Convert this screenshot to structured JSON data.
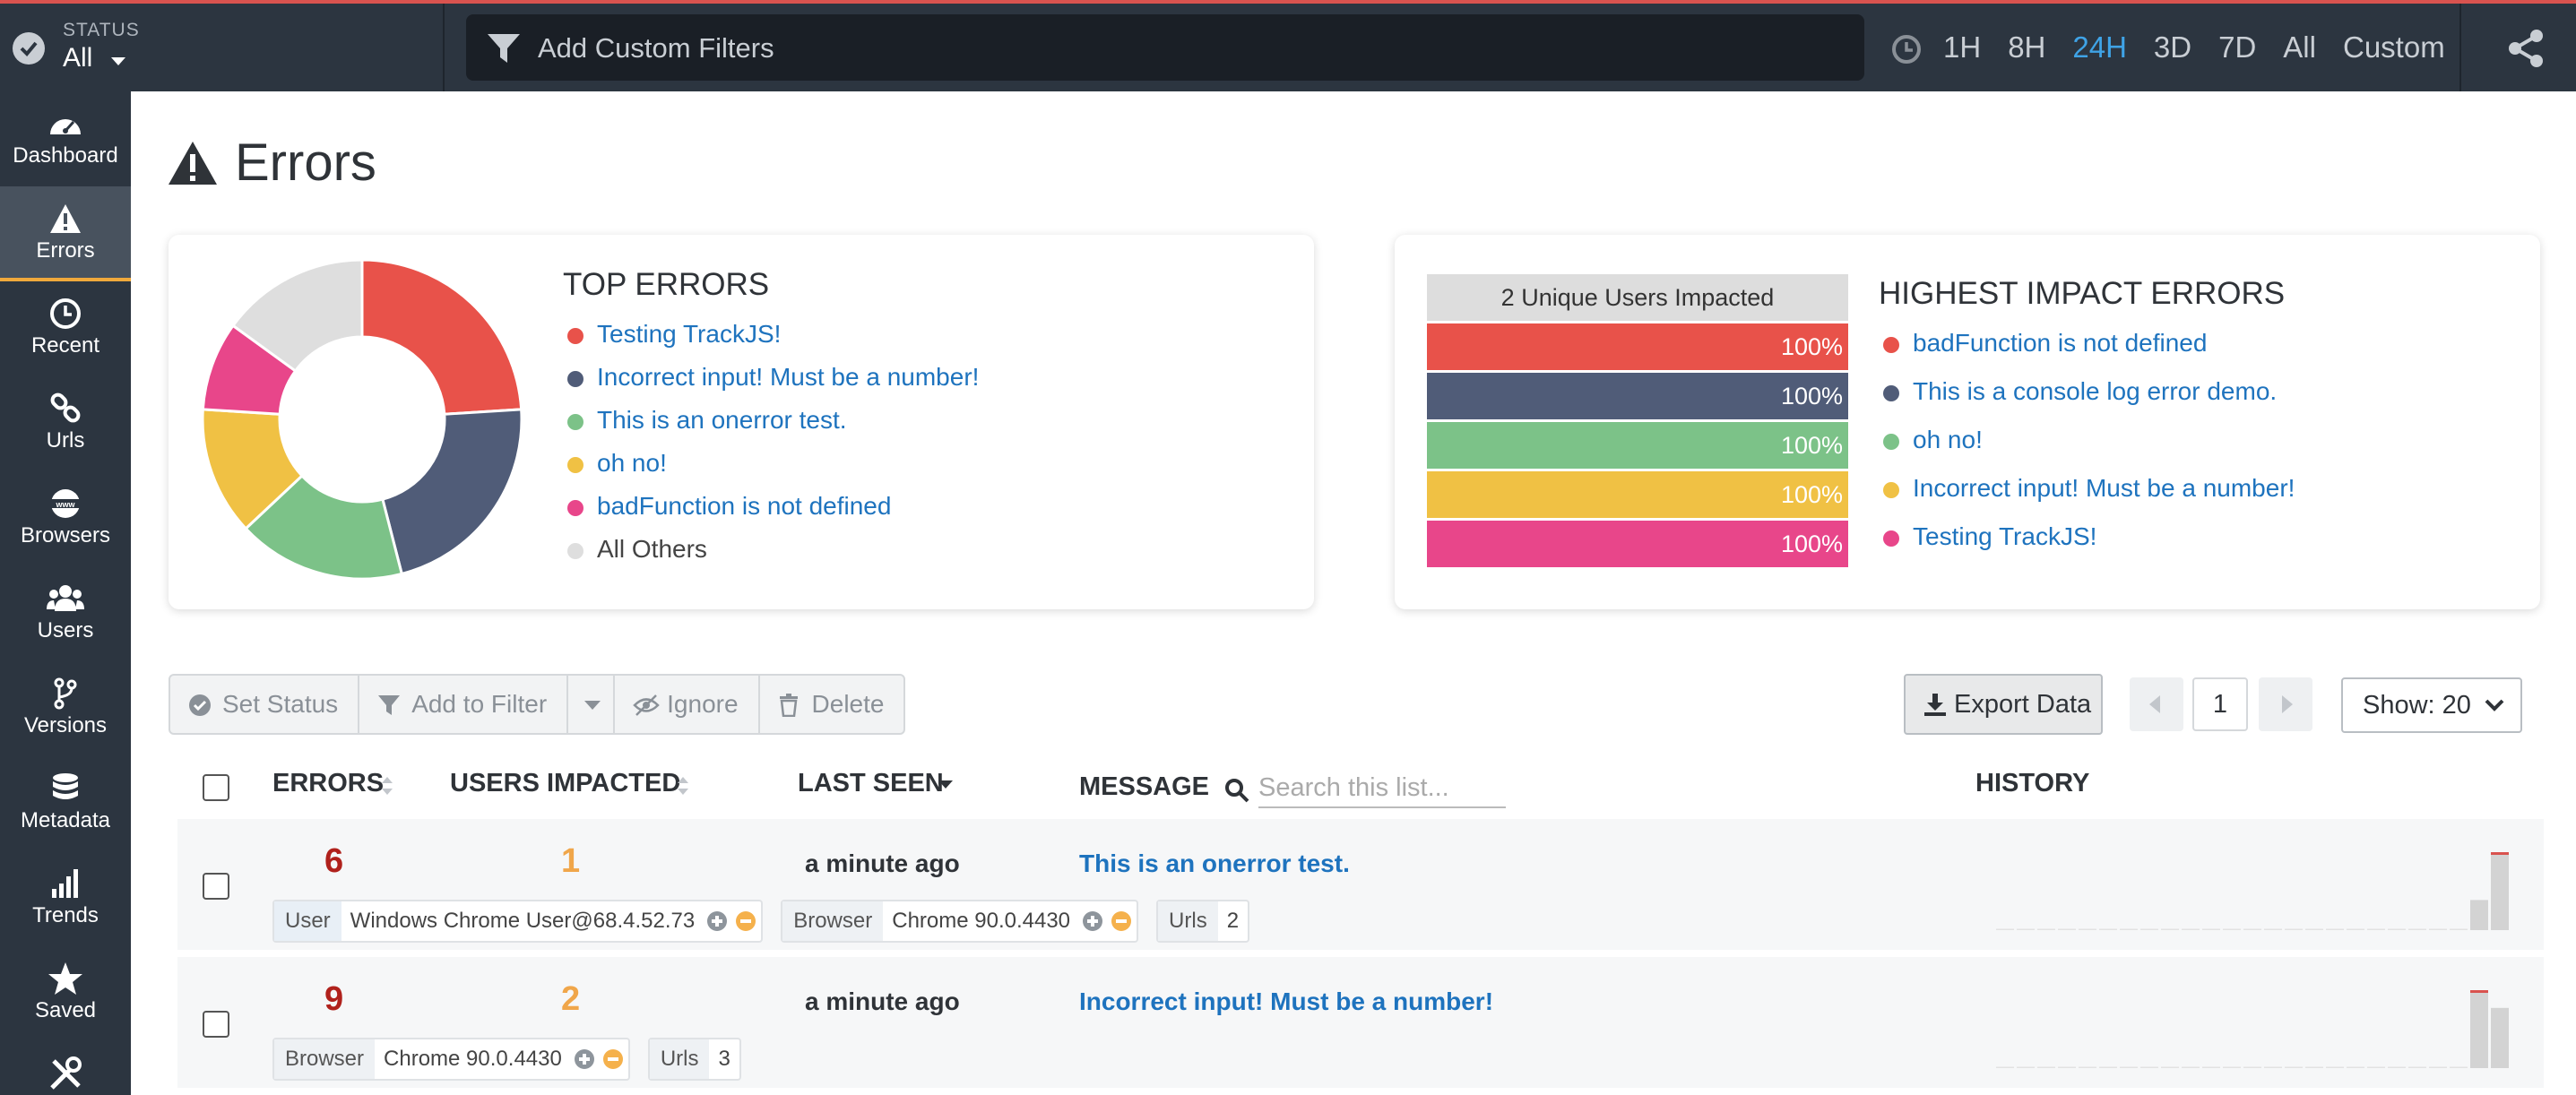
{
  "topbar": {
    "status_caption": "STATUS",
    "status_value": "All",
    "filter_placeholder": "Add Custom Filters",
    "time_ranges": [
      "1H",
      "8H",
      "24H",
      "3D",
      "7D",
      "All",
      "Custom"
    ],
    "active_range": "24H",
    "accent_color": "#3fa3e6"
  },
  "sidebar": {
    "items": [
      {
        "label": "Dashboard",
        "icon": "dashboard-icon"
      },
      {
        "label": "Errors",
        "icon": "warning-icon",
        "active": true
      },
      {
        "label": "Recent",
        "icon": "clock-icon"
      },
      {
        "label": "Urls",
        "icon": "link-icon"
      },
      {
        "label": "Browsers",
        "icon": "www-icon"
      },
      {
        "label": "Users",
        "icon": "users-icon"
      },
      {
        "label": "Versions",
        "icon": "branch-icon"
      },
      {
        "label": "Metadata",
        "icon": "database-icon"
      },
      {
        "label": "Trends",
        "icon": "bar-chart-icon"
      },
      {
        "label": "Saved",
        "icon": "star-icon"
      },
      {
        "label": "",
        "icon": "tools-icon"
      }
    ]
  },
  "page": {
    "title": "Errors"
  },
  "top_errors": {
    "title": "TOP ERRORS",
    "items": [
      {
        "label": "Testing TrackJS!",
        "color": "#e8524a",
        "share": 0.24
      },
      {
        "label": "Incorrect input! Must be a number!",
        "color": "#505c78",
        "share": 0.22
      },
      {
        "label": "This is an onerror test.",
        "color": "#7cc288",
        "share": 0.17
      },
      {
        "label": "oh no!",
        "color": "#f0c144",
        "share": 0.13
      },
      {
        "label": "badFunction is not defined",
        "color": "#e8468a",
        "share": 0.09
      },
      {
        "label": "All Others",
        "color": "#dedede",
        "share": 0.15
      }
    ]
  },
  "impact": {
    "title": "HIGHEST IMPACT ERRORS",
    "bar_header": "2 Unique Users Impacted",
    "items": [
      {
        "label": "badFunction is not defined",
        "percent": "100%",
        "color": "#e8524a"
      },
      {
        "label": "This is a console log error demo.",
        "percent": "100%",
        "color": "#505c78"
      },
      {
        "label": "oh no!",
        "percent": "100%",
        "color": "#7cc288"
      },
      {
        "label": "Incorrect input! Must be a number!",
        "percent": "100%",
        "color": "#f0c144"
      },
      {
        "label": "Testing TrackJS!",
        "percent": "100%",
        "color": "#e8468a"
      }
    ]
  },
  "toolbar": {
    "set_status": "Set Status",
    "add_to_filter": "Add to Filter",
    "ignore": "Ignore",
    "delete": "Delete",
    "export": "Export Data",
    "page": "1",
    "show": "Show: 20"
  },
  "table": {
    "headers": {
      "errors": "ERRORS",
      "users": "USERS IMPACTED",
      "last_seen": "LAST SEEN",
      "message": "MESSAGE",
      "history": "HISTORY"
    },
    "search_placeholder": "Search this list...",
    "rows": [
      {
        "errors": "6",
        "users": "1",
        "last_seen": "a minute ago",
        "message": "This is an onerror test.",
        "tags": [
          {
            "key": "User",
            "value": "Windows Chrome User@68.4.52.73",
            "filterable": true
          },
          {
            "key": "Browser",
            "value": "Chrome 90.0.4430",
            "filterable": true
          },
          {
            "key": "Urls",
            "value": "2",
            "filterable": false
          }
        ],
        "history": [
          0,
          0,
          0,
          0,
          0,
          0,
          0,
          0,
          0,
          0,
          0,
          0,
          0,
          0,
          0,
          0,
          0,
          0,
          0,
          0,
          0,
          0,
          0,
          2,
          5
        ]
      },
      {
        "errors": "9",
        "users": "2",
        "last_seen": "a minute ago",
        "message": "Incorrect input! Must be a number!",
        "tags": [
          {
            "key": "Browser",
            "value": "Chrome 90.0.4430",
            "filterable": true
          },
          {
            "key": "Urls",
            "value": "3",
            "filterable": false
          }
        ],
        "history": [
          0,
          0,
          0,
          0,
          0,
          0,
          0,
          0,
          0,
          0,
          0,
          0,
          0,
          0,
          0,
          0,
          0,
          0,
          0,
          0,
          0,
          0,
          0,
          5,
          4
        ]
      }
    ]
  }
}
